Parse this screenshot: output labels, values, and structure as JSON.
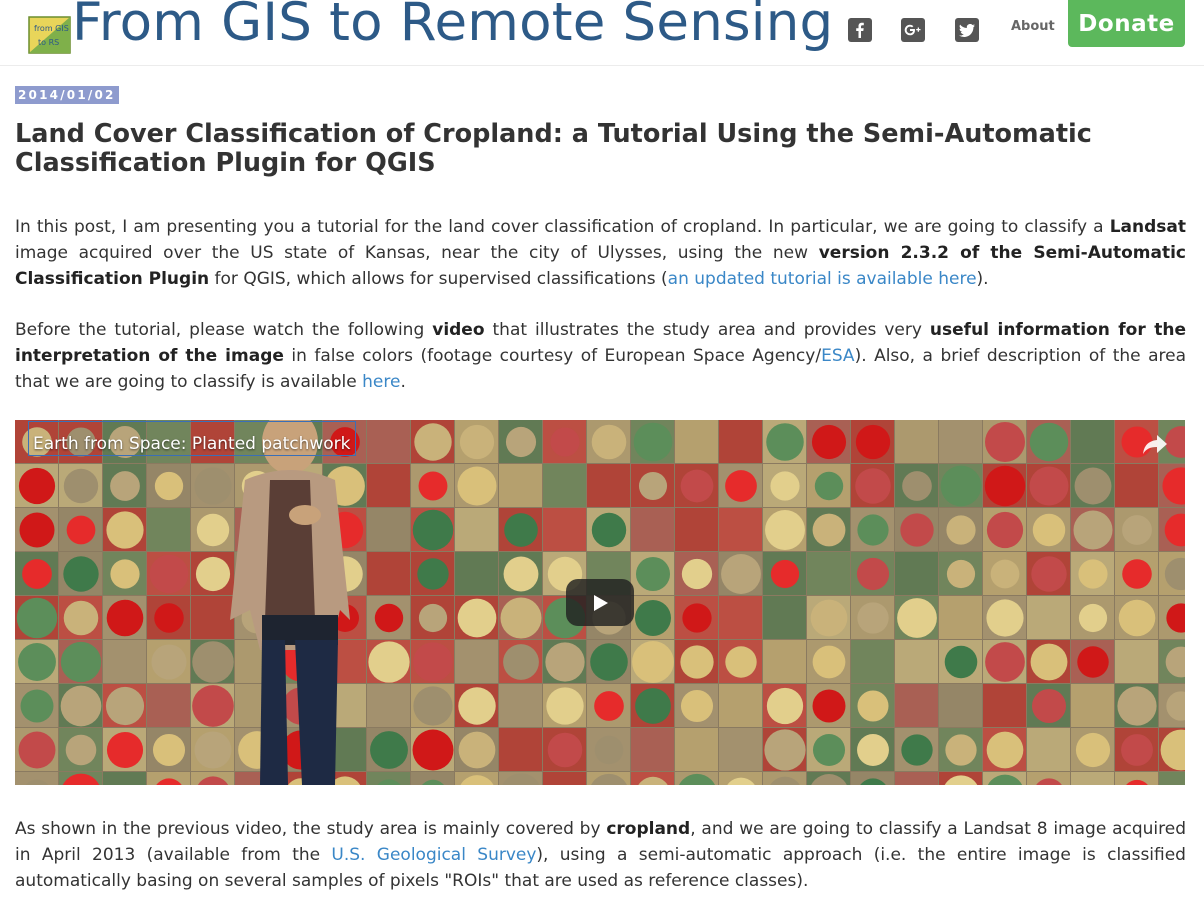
{
  "header": {
    "site_title": "From GIS to Remote Sensing",
    "logo_text": [
      "from GIS",
      "to RS"
    ],
    "about_label": "About",
    "donate_label": "Donate",
    "social_icons": [
      "facebook-icon",
      "google-plus-icon",
      "twitter-icon"
    ]
  },
  "post": {
    "date": "2014/01/02",
    "title": "Land Cover Classification of Cropland: a Tutorial Using the Semi-Automatic Classification Plugin for QGIS",
    "p1": {
      "t1": "In this post, I am presenting you a tutorial for the land cover classification of cropland. In particular, we are going to classify a ",
      "b1": "Landsat",
      "t2": " image acquired over the US state of Kansas, near the city of Ulysses, using the new ",
      "b2": "version 2.3.2 of the Semi-Automatic Classification Plugin",
      "t3": " for QGIS, which allows for supervised classifications (",
      "link": "an updated tutorial is available here",
      "t4": ")."
    },
    "p2": {
      "t1": "Before the tutorial, please watch the following ",
      "b1": "video",
      "t2": " that illustrates the study area and provides very ",
      "b2": "useful information for the interpretation of the image",
      "t3": " in false colors (footage courtesy of European Space Agency/",
      "link1": "ESA",
      "t4": "). Also, a brief description of the area that we are going to classify is available ",
      "link2": "here",
      "t5": "."
    },
    "video": {
      "title": "Earth from Space: Planted patchwork"
    },
    "p3": {
      "t1": "As shown in the previous video, the study area is mainly covered by ",
      "b1": "cropland",
      "t2": ", and we are going to classify a Landsat 8 image acquired in April 2013 (available from the ",
      "link": "U.S. Geological Survey",
      "t3": "), using a semi-automatic approach (i.e. the entire image is classified automatically basing on several samples of pixels \"ROIs\" that are used as reference classes)."
    }
  },
  "colors": {
    "title_blue": "#2d5a87",
    "donate_green": "#5cb85c",
    "date_badge": "#8e9bce",
    "link_blue": "#3a87c7"
  }
}
